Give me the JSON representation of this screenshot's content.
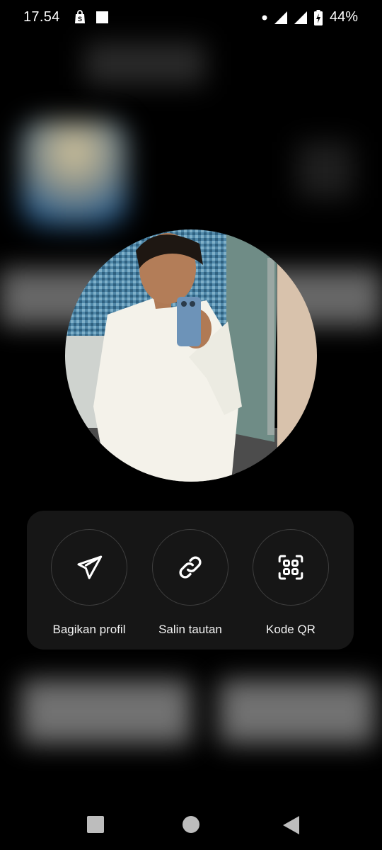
{
  "status_bar": {
    "time": "17.54",
    "battery": "44%"
  },
  "share_sheet": {
    "actions": [
      {
        "label": "Bagikan profil",
        "icon": "send-icon"
      },
      {
        "label": "Salin tautan",
        "icon": "link-icon"
      },
      {
        "label": "Kode QR",
        "icon": "qr-scan-icon"
      }
    ]
  },
  "navigation_bar": {
    "buttons": [
      "recents-icon",
      "home-icon",
      "back-icon"
    ]
  },
  "colors": {
    "background": "#000000",
    "panel": "#161616",
    "circle_border": "#3e3e3e",
    "text": "#f2f2f2"
  }
}
